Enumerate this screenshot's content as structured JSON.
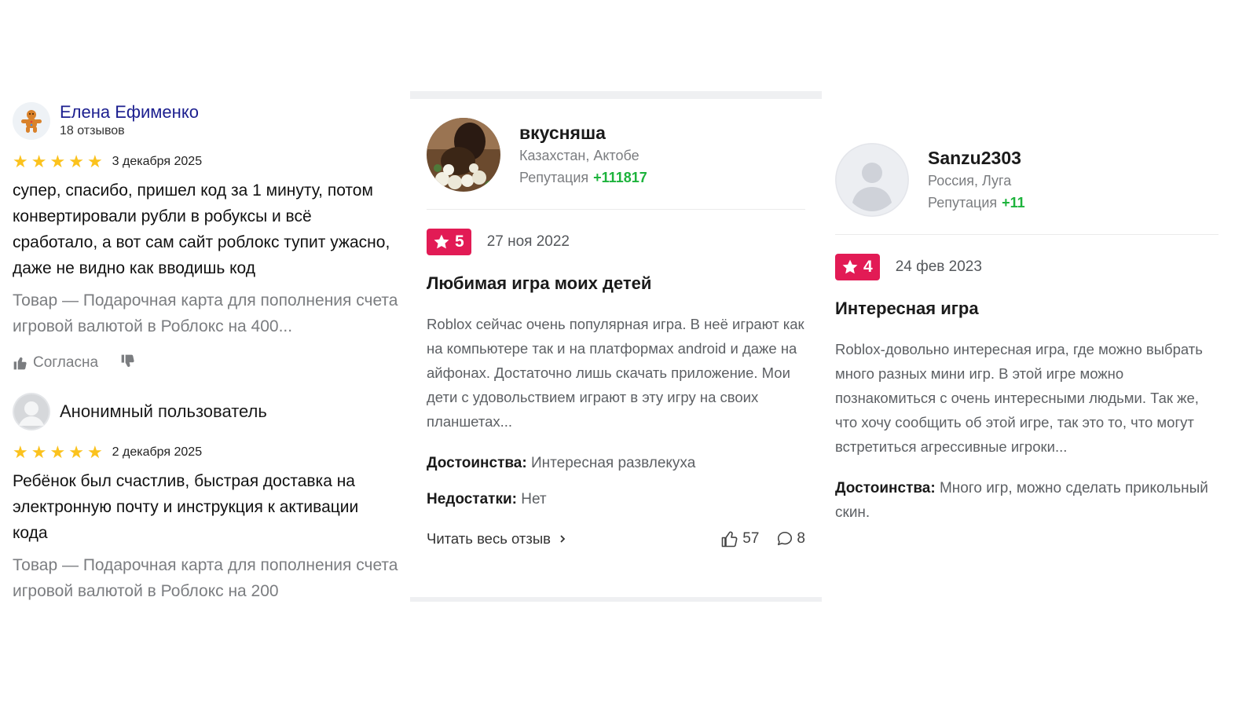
{
  "left": {
    "reviews": [
      {
        "author": "Елена Ефименко",
        "count": "18 отзывов",
        "date": "3 декабря 2025",
        "rating": 5,
        "text": "супер, спасибо, пришел код за 1 минуту, потом конвертировали рубли в робуксы и всё сработало, а вот сам сайт роблокс тупит ужасно, даже не видно как вводишь код",
        "product": "Товар — Подарочная карта для пополнения счета игровой валютой в Роблокс на 400...",
        "agree_label": "Согласна"
      },
      {
        "author": "Анонимный пользователь",
        "date": "2 декабря 2025",
        "rating": 5,
        "text": "Ребёнок был счастлив, быстрая доставка на электронную почту и инструкция к активации кода",
        "product": "Товар — Подарочная карта для пополнения счета игровой валютой в Роблокс на 200"
      }
    ]
  },
  "middle": {
    "user": "вкусняша",
    "location": "Казахстан, Актобе",
    "reputation_label": "Репутация",
    "reputation_value": "+111817",
    "rating": "5",
    "date": "27 ноя 2022",
    "title": "Любимая игра моих детей",
    "body": "Roblox сейчас очень популярная игра. В неё играют как на компьютере так и на платформах android и даже на айфонах. Достаточно лишь скачать приложение. Мои дети с удовольствием играют в эту игру на своих планшетах...",
    "pros_label": "Достоинства:",
    "pros": "Интересная развлекуха",
    "cons_label": "Недостатки:",
    "cons": "Нет",
    "read_more": "Читать весь отзыв",
    "likes": "57",
    "comments": "8"
  },
  "right": {
    "user": "Sanzu2303",
    "location": "Россия, Луга",
    "reputation_label": "Репутация",
    "reputation_value": "+11",
    "rating": "4",
    "date": "24 фев 2023",
    "title": "Интересная игра",
    "body": "Roblox-довольно интересная игра, где можно выбрать много разных мини игр. В этой игре можно познакомиться с очень интересными людьми. Так же, что хочу сообщить об этой игре, так это то, что могут встретиться агрессивные игроки...",
    "pros_label": "Достоинства:",
    "pros": "Много игр, можно сделать прикольный скин."
  },
  "colors": {
    "star": "#fbc21d",
    "badge": "#e21b55",
    "reputation": "#1db33c",
    "author_link": "#1c1f8f"
  },
  "icons": [
    "gingerbread-avatar-icon",
    "anonymous-avatar-icon",
    "star-icon",
    "thumbs-up-icon",
    "thumbs-down-icon",
    "chevron-right-icon",
    "like-icon",
    "comment-icon",
    "default-user-icon"
  ]
}
